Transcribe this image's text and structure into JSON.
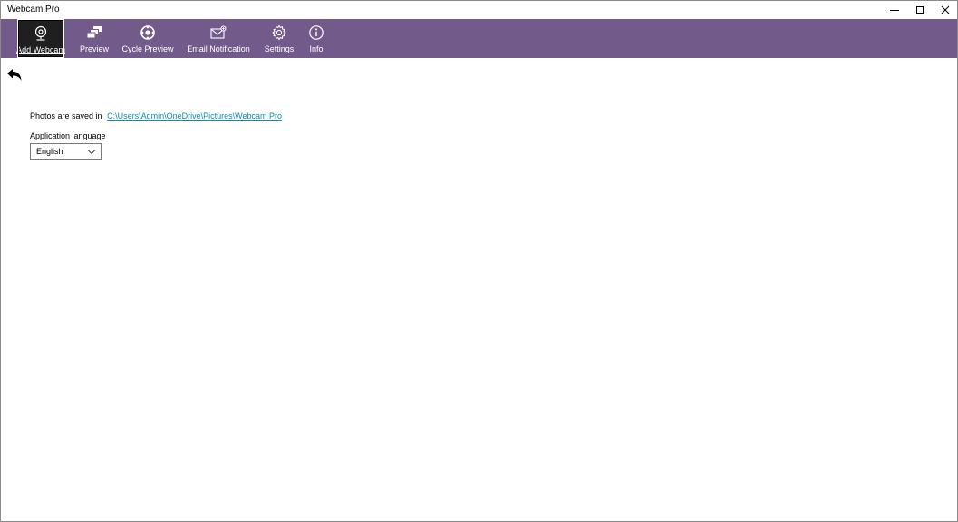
{
  "window": {
    "title": "Webcam Pro"
  },
  "toolbar": {
    "items": [
      {
        "label": "Add Webcam",
        "icon": "webcam-icon",
        "selected": true
      },
      {
        "label": "Preview",
        "icon": "preview-icon"
      },
      {
        "label": "Cycle Preview",
        "icon": "cycle-icon"
      },
      {
        "label": "Email Notification",
        "icon": "email-icon"
      },
      {
        "label": "Settings",
        "icon": "gear-icon"
      },
      {
        "label": "Info",
        "icon": "info-icon"
      }
    ]
  },
  "settings": {
    "saved_prefix": "Photos are saved in",
    "saved_path": "C:\\Users\\Admin\\OneDrive\\Pictures\\Webcam Pro",
    "language_label": "Application language",
    "language_value": "English"
  },
  "colors": {
    "toolbar_bg": "#725a8a",
    "link": "#0a8fa8"
  }
}
